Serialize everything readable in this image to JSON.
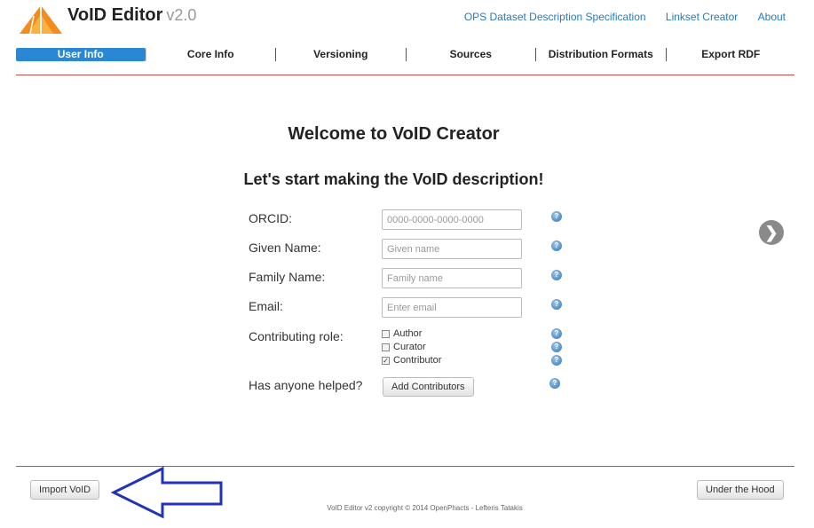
{
  "header": {
    "title": "VoID Editor",
    "version": "v2.0",
    "links": [
      "OPS Dataset Description Specification",
      "Linkset Creator",
      "About"
    ]
  },
  "tabs": [
    {
      "label": "User Info",
      "active": true
    },
    {
      "label": "Core Info",
      "active": false
    },
    {
      "label": "Versioning",
      "active": false
    },
    {
      "label": "Sources",
      "active": false
    },
    {
      "label": "Distribution Formats",
      "active": false
    },
    {
      "label": "Export RDF",
      "active": false
    }
  ],
  "main": {
    "welcome": "Welcome to VoID Creator",
    "subtitle": "Let's start making the VoID description!",
    "form": {
      "orcid": {
        "label": "ORCID:",
        "placeholder": "0000-0000-0000-0000",
        "value": ""
      },
      "given_name": {
        "label": "Given Name:",
        "placeholder": "Given name",
        "value": ""
      },
      "family_name": {
        "label": "Family Name:",
        "placeholder": "Family name",
        "value": ""
      },
      "email": {
        "label": "Email:",
        "placeholder": "Enter email",
        "value": ""
      },
      "role": {
        "label": "Contributing role:",
        "options": [
          {
            "label": "Author",
            "checked": false
          },
          {
            "label": "Curator",
            "checked": false
          },
          {
            "label": "Contributor",
            "checked": true
          }
        ]
      },
      "helped": {
        "label": "Has anyone helped?",
        "button": "Add Contributors"
      }
    },
    "next_glyph": "❯"
  },
  "footer": {
    "import_label": "Import VoID",
    "under_hood_label": "Under the Hood",
    "copyright": "VoID Editor v2 copyright © 2014 OpenPhacts - Lefteris Tatakis"
  },
  "icons": {
    "logo": "triangle-logo-icon",
    "help": "question-help-icon",
    "next": "chevron-right-icon",
    "annotation": "arrow-left-outline-icon"
  },
  "colors": {
    "accent_blue": "#2a87d3",
    "link_blue": "#2a7ab8",
    "rule_red": "#c0504d",
    "logo_orange": "#f28c1e",
    "annotation_arrow": "#2233bb"
  }
}
